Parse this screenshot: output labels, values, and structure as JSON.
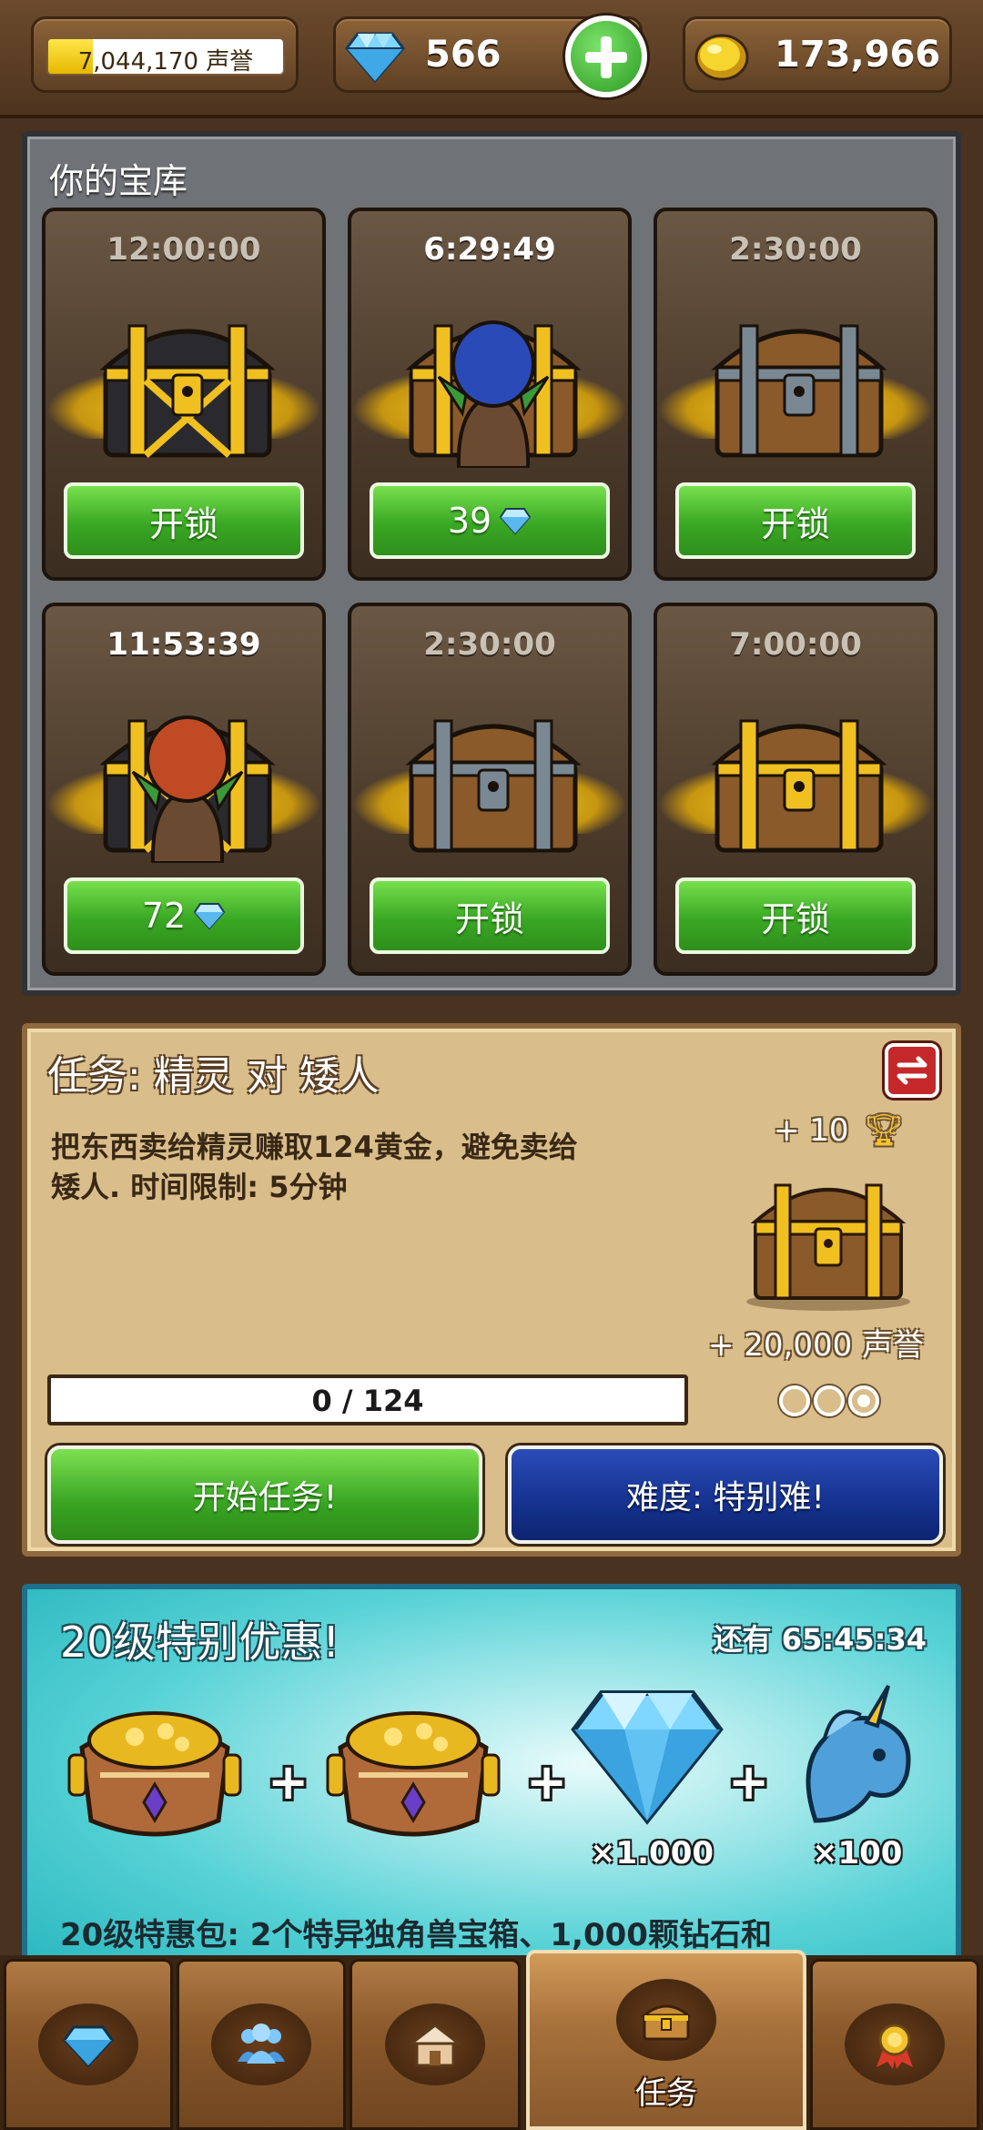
{
  "header": {
    "fame_text": "7,044,170 声誉",
    "fame_progress": 0.19,
    "gems": "566",
    "gold": "173,966"
  },
  "vault": {
    "title": "你的宝库",
    "chests": [
      {
        "timer": "12:00:00",
        "type": "black-gold-chest",
        "button": "开锁",
        "active": false
      },
      {
        "timer": "6:29:49",
        "type": "wooden-chest-with-goblin",
        "button": "39",
        "gem": true,
        "active": true
      },
      {
        "timer": "2:30:00",
        "type": "iron-wooden-chest",
        "button": "开锁",
        "active": false
      },
      {
        "timer": "11:53:39",
        "type": "black-gold-chest-with-goblin",
        "button": "72",
        "gem": true,
        "active": true
      },
      {
        "timer": "2:30:00",
        "type": "iron-wooden-chest",
        "button": "开锁",
        "active": false
      },
      {
        "timer": "7:00:00",
        "type": "gold-wooden-chest",
        "button": "开锁",
        "active": false
      }
    ]
  },
  "quest": {
    "title": "任务: 精灵 对 矮人",
    "description_line1": "把东西卖给精灵赚取124黄金，避免卖给",
    "description_line2": "矮人. 时间限制: 5分钟",
    "reward_trophy": "+ 10",
    "reward_fame": "+ 20,000 声誉",
    "progress_text": "0 / 124",
    "progress": 0,
    "start_button": "开始任务!",
    "difficulty_button": "难度: 特别难!"
  },
  "offer": {
    "title": "20级特别优惠!",
    "timer": "还有 65:45:34",
    "gem_qty": "×1.000",
    "unicorn_qty": "×100",
    "description": "20级特惠包: 2个特异独角兽宝箱、1,000颗钻石和"
  },
  "nav": {
    "active_label": "任务",
    "tabs": [
      "gem-shop-icon",
      "people-icon",
      "house-icon",
      "chest-icon",
      "medal-icon"
    ]
  },
  "colors": {
    "unlock_green": "#3aa824",
    "difficulty_blue": "#15328f",
    "offer_cyan": "#56d2d6"
  }
}
